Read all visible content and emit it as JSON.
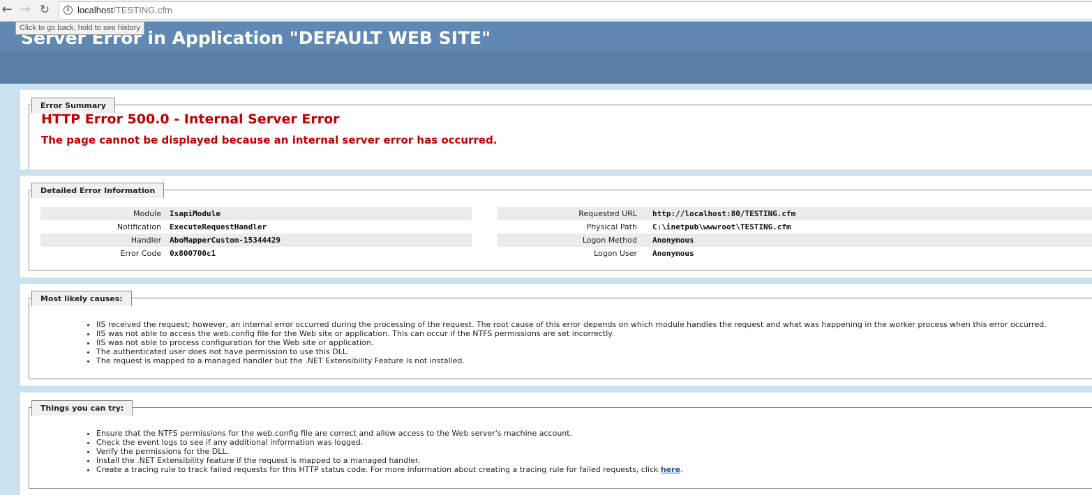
{
  "browser": {
    "url_host": "localhost",
    "url_path": "/TESTING.cfm",
    "back_icon": "←",
    "forward_icon": "→",
    "reload_icon": "↻",
    "info_icon": "i",
    "tooltip": "Click to go back, hold to see history"
  },
  "header": {
    "title": "Server Error in Application \"DEFAULT WEB SITE\""
  },
  "summary": {
    "legend": "Error Summary",
    "heading": "HTTP Error 500.0 - Internal Server Error",
    "subheading": "The page cannot be displayed because an internal server error has occurred."
  },
  "details": {
    "legend": "Detailed Error Information",
    "left": [
      {
        "label": "Module",
        "value": "IsapiModule"
      },
      {
        "label": "Notification",
        "value": "ExecuteRequestHandler"
      },
      {
        "label": "Handler",
        "value": "AboMapperCustom-15344429"
      },
      {
        "label": "Error Code",
        "value": "0x800700c1"
      }
    ],
    "right": [
      {
        "label": "Requested URL",
        "value": "http://localhost:80/TESTING.cfm"
      },
      {
        "label": "Physical Path",
        "value": "C:\\inetpub\\wwwroot\\TESTING.cfm"
      },
      {
        "label": "Logon Method",
        "value": "Anonymous"
      },
      {
        "label": "Logon User",
        "value": "Anonymous"
      }
    ]
  },
  "causes": {
    "legend": "Most likely causes:",
    "items": [
      "IIS received the request; however, an internal error occurred during the processing of the request. The root cause of this error depends on which module handles the request and what was happening in the worker process when this error occurred.",
      "IIS was not able to access the web.config file for the Web site or application. This can occur if the NTFS permissions are set incorrectly.",
      "IIS was not able to process configuration for the Web site or application.",
      "The authenticated user does not have permission to use this DLL.",
      "The request is mapped to a managed handler but the .NET Extensibility Feature is not installed."
    ]
  },
  "try": {
    "legend": "Things you can try:",
    "items": [
      "Ensure that the NTFS permissions for the web.config file are correct and allow access to the Web server's machine account.",
      "Check the event logs to see if any additional information was logged.",
      "Verify the permissions for the DLL.",
      "Install the .NET Extensibility feature if the request is mapped to a managed handler."
    ],
    "last_item_text": "Create a tracing rule to track failed requests for this HTTP status code. For more information about creating a tracing rule for failed requests, click ",
    "last_item_link": "here",
    "last_item_end": "."
  }
}
